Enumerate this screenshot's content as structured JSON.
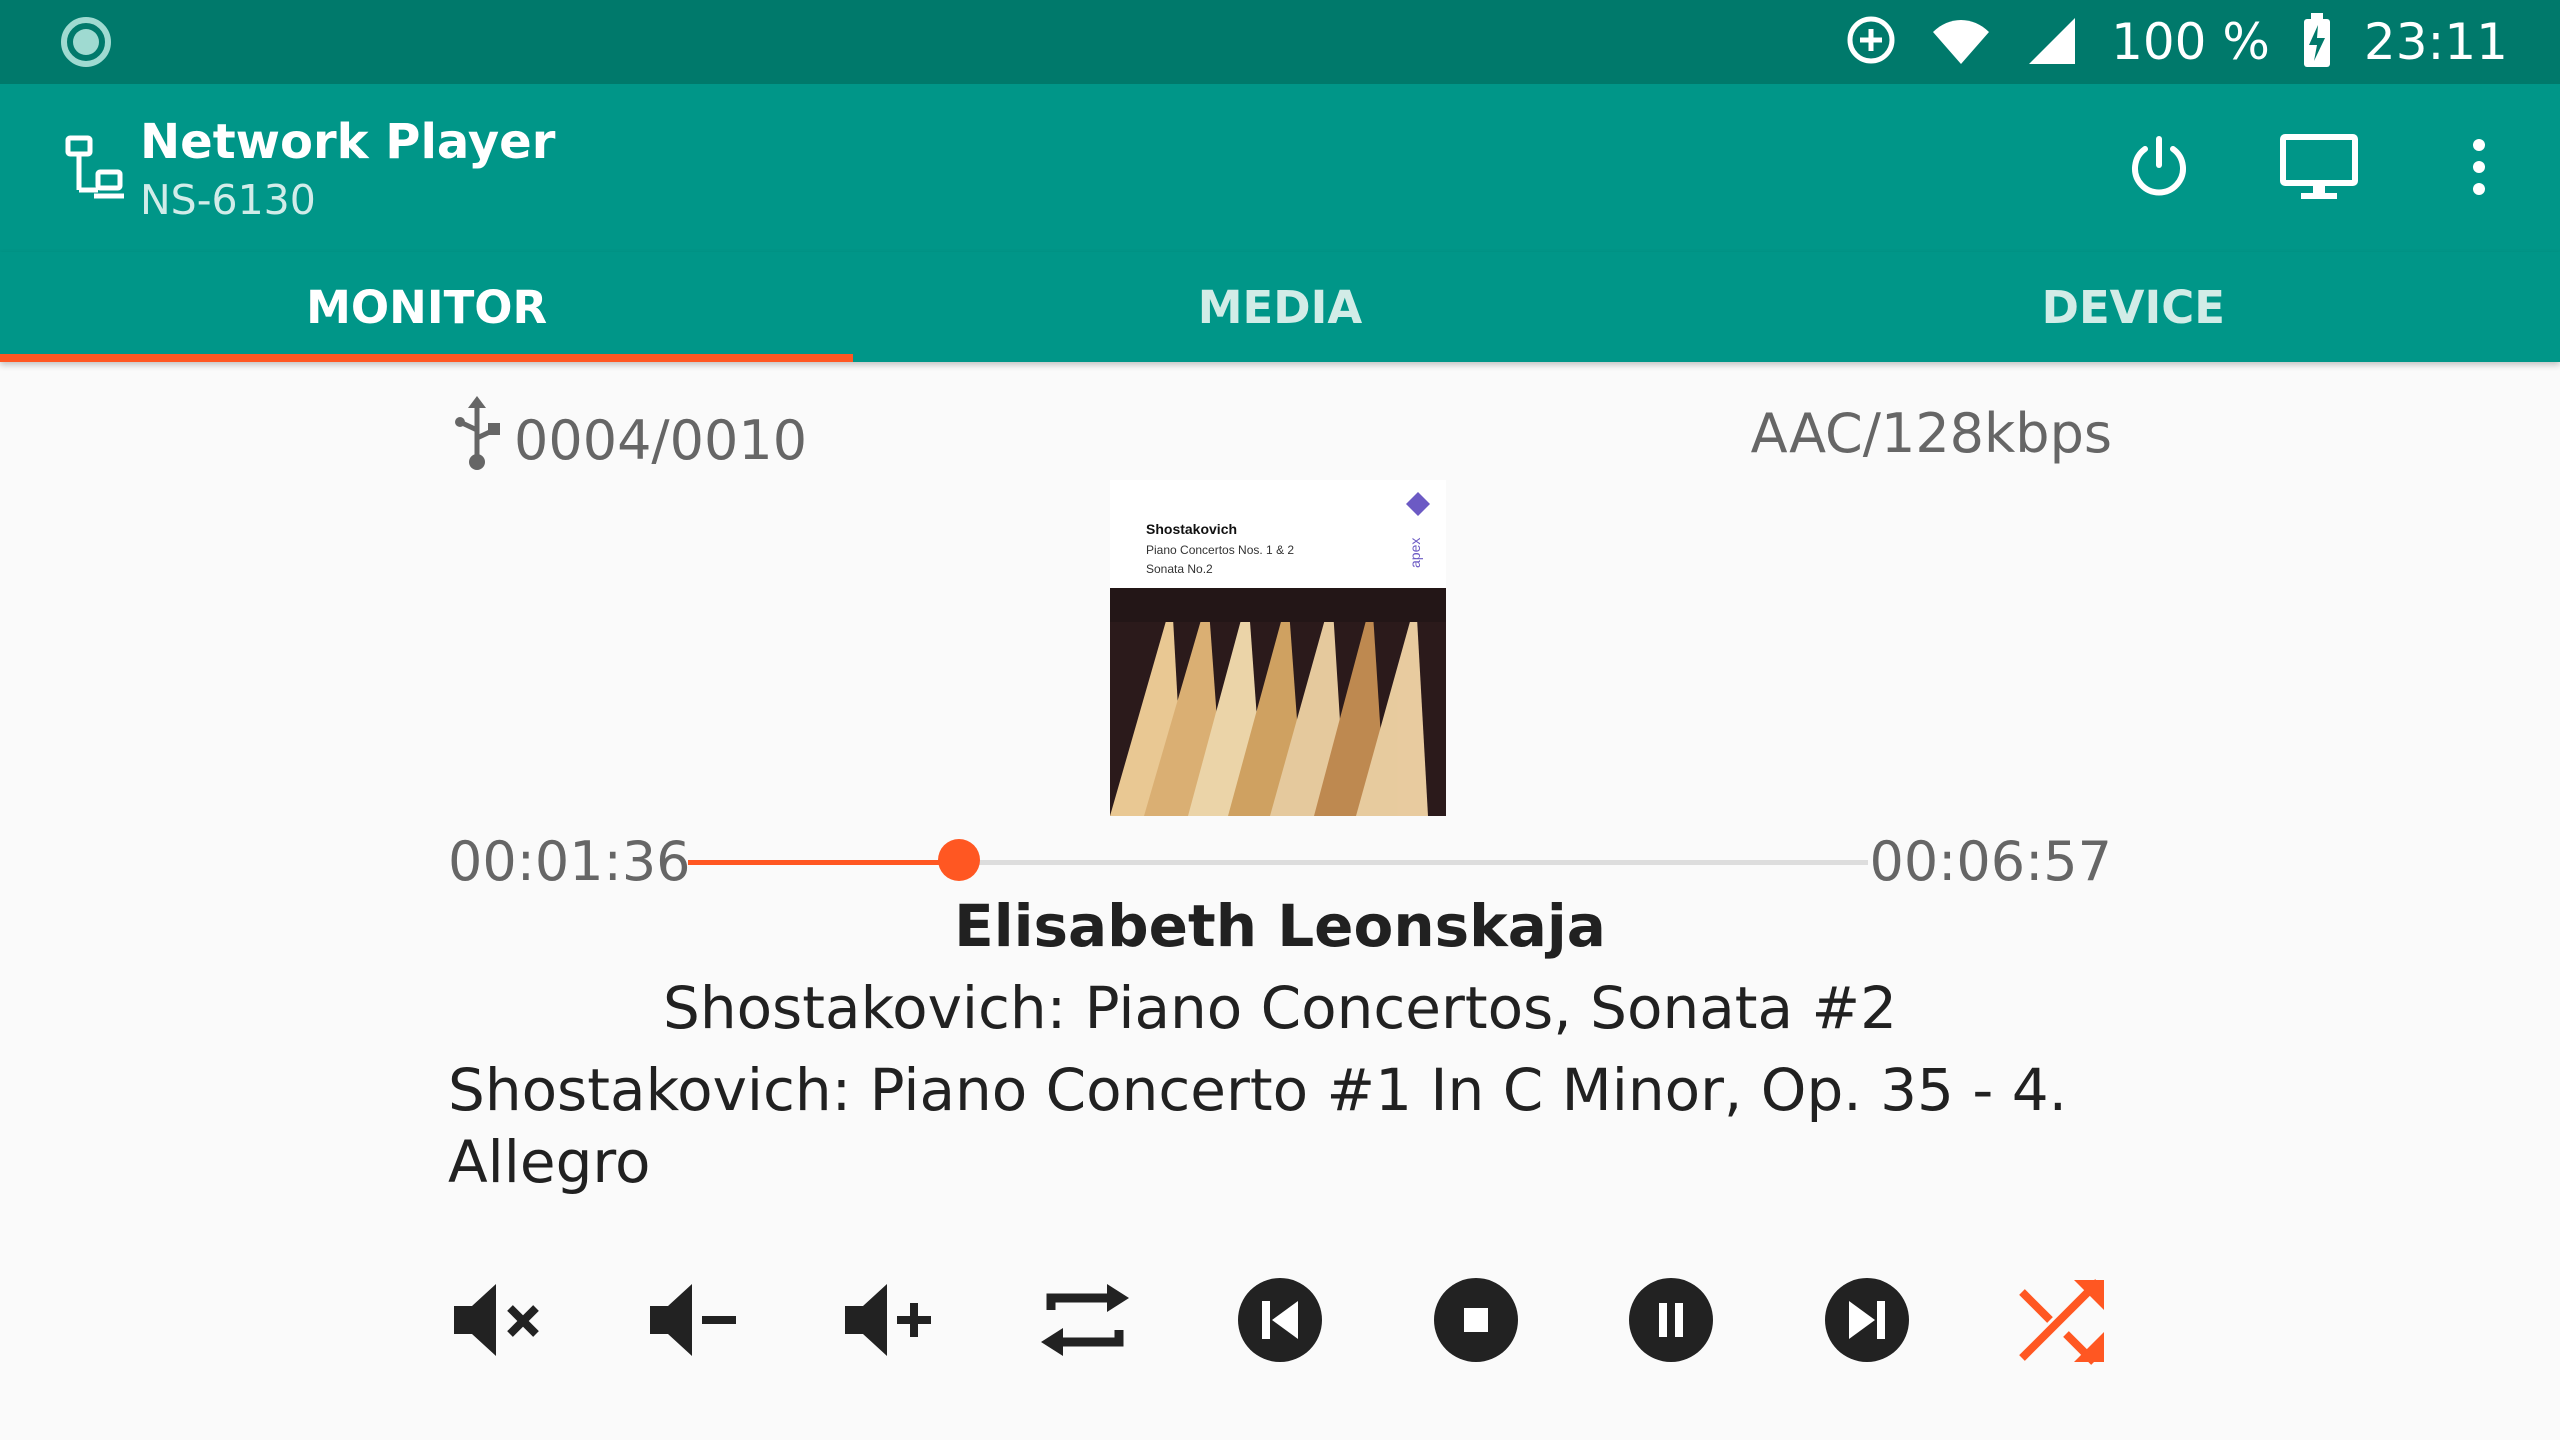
{
  "status_bar": {
    "battery": "100 %",
    "time": "23:11",
    "icons": [
      "loading-icon",
      "data-saver-icon",
      "wifi-icon",
      "cell-signal-icon",
      "battery-charging-icon"
    ]
  },
  "app_bar": {
    "title": "Network Player",
    "subtitle": "NS-6130",
    "actions": [
      "power-icon",
      "monitor-icon",
      "more-vert-icon"
    ]
  },
  "tabs": [
    {
      "label": "MONITOR",
      "active": true
    },
    {
      "label": "MEDIA",
      "active": false
    },
    {
      "label": "DEVICE",
      "active": false
    }
  ],
  "player": {
    "source_icon": "usb-icon",
    "track_counter": "0004/0010",
    "format": "AAC/128kbps",
    "elapsed": "00:01:36",
    "duration": "00:06:57",
    "progress_fraction": 0.23,
    "artist": "Elisabeth Leonskaja",
    "album": "Shostakovich: Piano Concertos, Sonata #2",
    "title": "Shostakovich: Piano Concerto #1 In C Minor, Op. 35 - 4. Allegro",
    "album_art": {
      "heading": "Shostakovich",
      "line1": "Piano Concertos Nos. 1 & 2",
      "line2": "Sonata No.2",
      "brand": "apex"
    }
  },
  "controls": [
    "mute-icon",
    "volume-down-icon",
    "volume-up-icon",
    "repeat-icon",
    "skip-previous-icon",
    "stop-icon",
    "pause-icon",
    "skip-next-icon",
    "shuffle-icon"
  ],
  "colors": {
    "status_bar": "#00796b",
    "app_bar": "#009688",
    "accent": "#ff5722",
    "background": "#fafafa"
  }
}
